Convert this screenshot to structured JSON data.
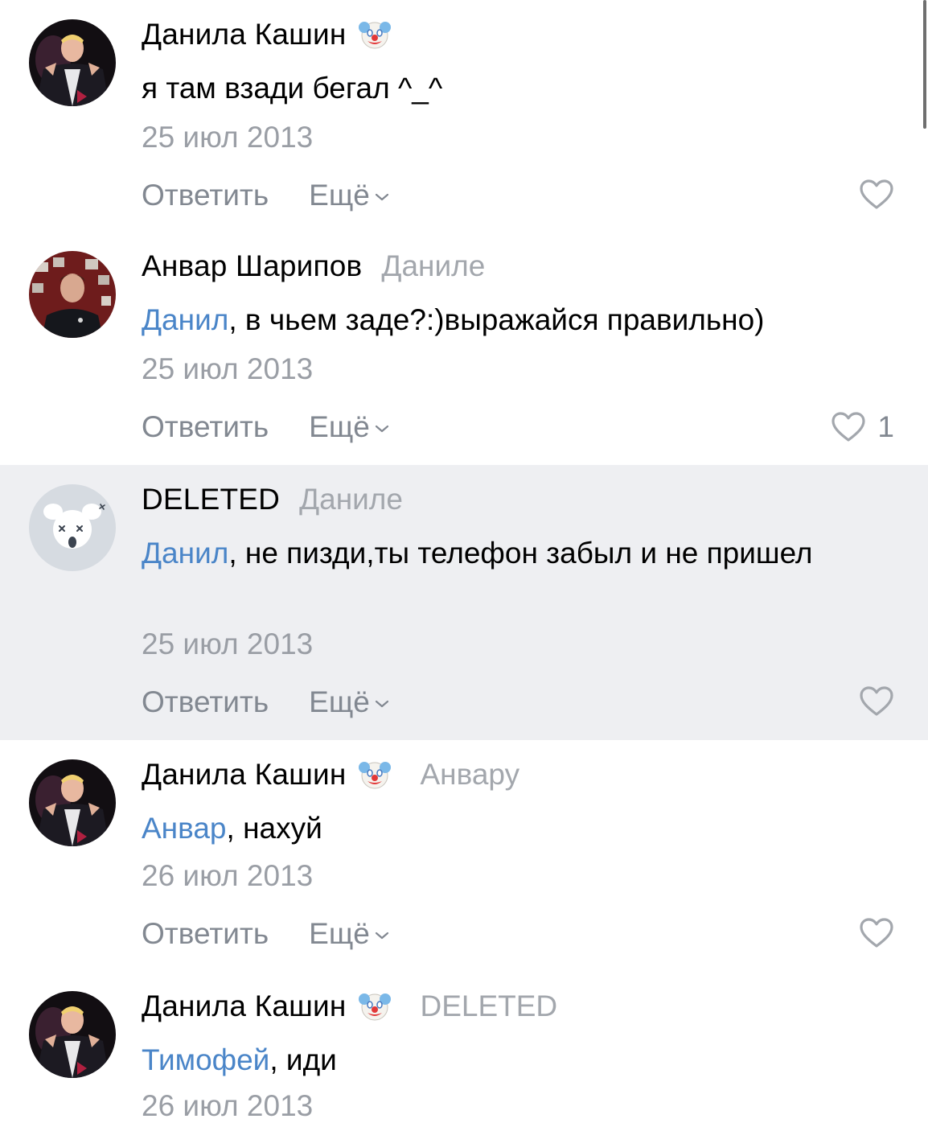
{
  "actions": {
    "reply": "Ответить",
    "more": "Ещё"
  },
  "comments": [
    {
      "author": "Данила Кашин",
      "badge": "clown-emoji",
      "reply_to": "",
      "mention": "",
      "text": "я там взади бегал ^_^",
      "date": "25 июл 2013",
      "likes": ""
    },
    {
      "author": "Анвар Шарипов",
      "badge": "",
      "reply_to": "Даниле",
      "mention": "Данил",
      "text": ", в чьем заде?:)выражайся правильно)",
      "date": "25 июл 2013",
      "likes": "1"
    },
    {
      "author": "DELETED",
      "badge": "",
      "reply_to": "Даниле",
      "mention": "Данил",
      "text": ", не пизди,ты телефон забыл и не пришел",
      "date": "25 июл 2013",
      "likes": ""
    },
    {
      "author": "Данила Кашин",
      "badge": "clown-emoji",
      "reply_to": "Анвару",
      "mention": "Анвар",
      "text": ", нахуй",
      "date": "26 июл 2013",
      "likes": ""
    },
    {
      "author": "Данила Кашин",
      "badge": "clown-emoji",
      "reply_to": "DELETED",
      "mention": "Тимофей",
      "text": ", иди",
      "date": "26 июл 2013",
      "likes": ""
    }
  ],
  "colors": {
    "mention": "#4a85c8",
    "meta": "#9a9ea5",
    "highlight_bg": "#eeeff2"
  }
}
